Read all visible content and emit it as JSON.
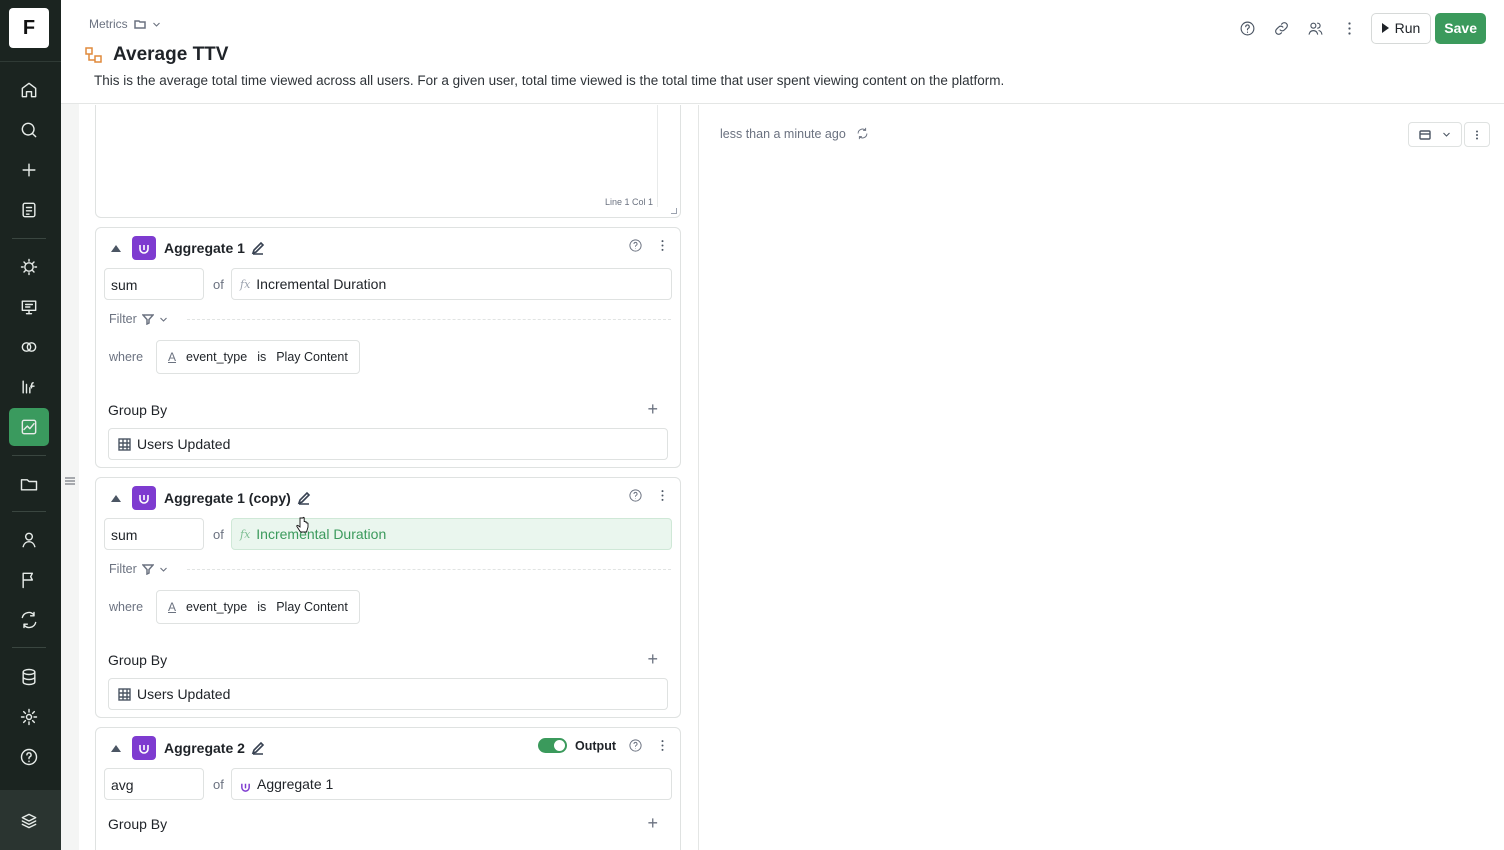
{
  "rail": {
    "logo": "F",
    "items": [
      "home-icon",
      "search-icon",
      "plus-icon",
      "notebook-icon",
      "lightbulb-icon",
      "presentation-icon",
      "circles-icon",
      "formula-icon",
      "metrics-icon",
      "folder-icon",
      "user-icon",
      "flag-icon",
      "refresh-icon",
      "database-icon",
      "settings-icon",
      "help-icon",
      "stack-icon"
    ],
    "active": "metrics-icon"
  },
  "header": {
    "breadcrumb": "Metrics",
    "title": "Average TTV",
    "description": "This is the average total time viewed across all users. For a given user, total time viewed is the total time that user spent viewing content on the platform.",
    "run_label": "Run",
    "save_label": "Save"
  },
  "editor": {
    "cursor_info": "Line 1 Col 1"
  },
  "aggregates": [
    {
      "title": "Aggregate 1",
      "function": "sum",
      "of": "of",
      "column": "Incremental Duration",
      "filter_label": "Filter",
      "where_label": "where",
      "condition": {
        "field": "event_type",
        "op": "is",
        "value": "Play Content"
      },
      "group_by_label": "Group By",
      "group_by": "Users Updated"
    },
    {
      "title": "Aggregate 1 (copy)",
      "function": "sum",
      "of": "of",
      "column": "Incremental Duration",
      "filter_label": "Filter",
      "where_label": "where",
      "condition": {
        "field": "event_type",
        "op": "is",
        "value": "Play Content"
      },
      "group_by_label": "Group By",
      "group_by": "Users Updated"
    },
    {
      "title": "Aggregate 2",
      "output_label": "Output",
      "output_enabled": true,
      "function": "avg",
      "of": "of",
      "column": "Aggregate 1",
      "group_by_label": "Group By"
    }
  ],
  "results": {
    "timestamp": "less than a minute ago"
  },
  "colors": {
    "accent": "#3b9a5c",
    "aggregate": "#7e3bd0",
    "rail": "#1b2420"
  }
}
